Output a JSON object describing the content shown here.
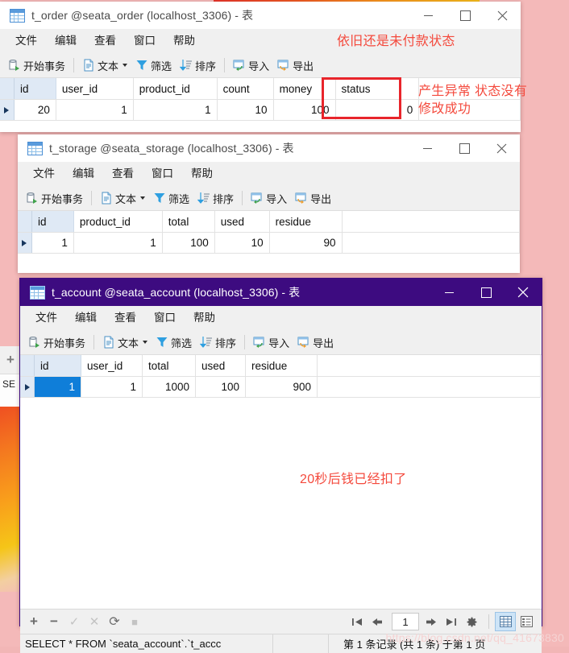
{
  "desktop": {
    "background_color": "#f4b9b9",
    "watermark": "https://blog.csdn.net/qq_41673830"
  },
  "background_window": {
    "add_icon": "plus-icon",
    "sql_fragment": "SE"
  },
  "menu": {
    "items": [
      "文件",
      "编辑",
      "查看",
      "窗口",
      "帮助"
    ]
  },
  "toolbar": {
    "begin_transaction": "开始事务",
    "text": "文本",
    "filter": "筛选",
    "sort": "排序",
    "import": "导入",
    "export": "导出"
  },
  "window_controls": {
    "minimize": "minimize-icon",
    "maximize": "maximize-icon",
    "close": "close-icon"
  },
  "windows": [
    {
      "id": "t_order",
      "title": "t_order @seata_order (localhost_3306) - 表",
      "active": false,
      "grid": {
        "columns": [
          "id",
          "user_id",
          "product_id",
          "count",
          "money",
          "status"
        ],
        "rows": [
          [
            "20",
            "1",
            "1",
            "10",
            "100",
            "0"
          ]
        ],
        "selected_row": 0,
        "selected_cell": null
      }
    },
    {
      "id": "t_storage",
      "title": "t_storage @seata_storage (localhost_3306) - 表",
      "active": false,
      "grid": {
        "columns": [
          "id",
          "product_id",
          "total",
          "used",
          "residue"
        ],
        "rows": [
          [
            "1",
            "1",
            "100",
            "10",
            "90"
          ]
        ],
        "selected_row": 0,
        "selected_cell": null
      }
    },
    {
      "id": "t_account",
      "title": "t_account @seata_account (localhost_3306) - 表",
      "active": true,
      "grid": {
        "columns": [
          "id",
          "user_id",
          "total",
          "used",
          "residue"
        ],
        "rows": [
          [
            "1",
            "1",
            "1000",
            "100",
            "900"
          ]
        ],
        "selected_row": 0,
        "selected_cell": 0
      },
      "navbar": {
        "add": "plus-icon",
        "remove": "minus-icon",
        "confirm": "check-icon",
        "cancel": "cross-icon",
        "refresh": "refresh-icon",
        "stop": "stop-icon",
        "first": "first-page-icon",
        "prev": "prev-page-icon",
        "page_value": "1",
        "next": "next-page-icon",
        "last": "last-page-icon",
        "settings": "gear-icon",
        "grid_view": "grid-view-icon",
        "form_view": "form-view-icon"
      },
      "statusbar": {
        "sql": "SELECT * FROM `seata_account`.`t_accc",
        "record_info": "第 1 条记录 (共 1 条) 于第 1 页"
      }
    }
  ],
  "annotations": [
    {
      "id": "note-unpaid",
      "text": "依旧还是未付款状态",
      "color": "#f4493c"
    },
    {
      "id": "note-exception",
      "text": "产生异常 状态没有\n修改成功",
      "color": "#f4493c"
    },
    {
      "id": "note-money-deducted",
      "text": "20秒后钱已经扣了",
      "color": "#f4493c"
    }
  ],
  "highlight_box": {
    "id": "status-column-highlight",
    "color": "#e8252b"
  }
}
